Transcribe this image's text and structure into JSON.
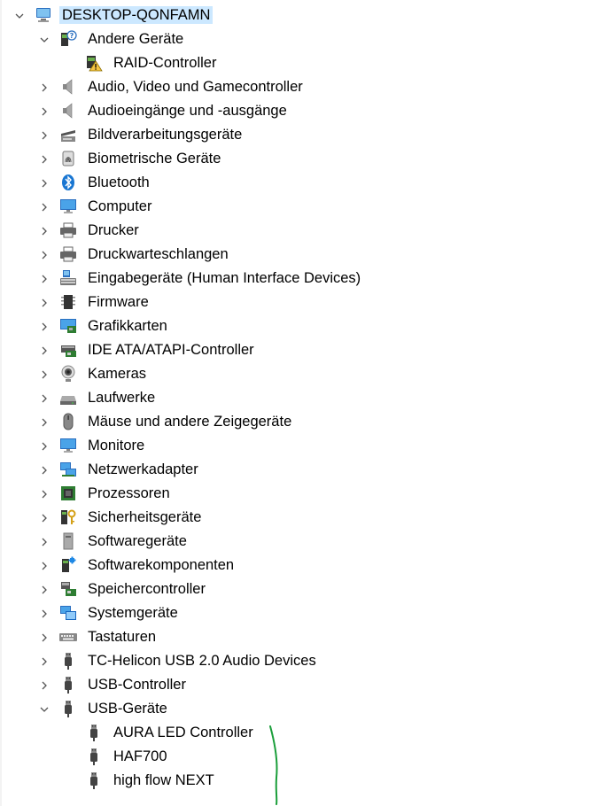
{
  "tree": {
    "root": {
      "label": "DESKTOP-QONFAMN",
      "icon": "computer-icon",
      "expanded": true
    },
    "groups": [
      {
        "label": "Andere Geräte",
        "icon": "unknown-device-icon",
        "expanded": true,
        "children": [
          {
            "label": "RAID-Controller",
            "icon": "warning-device-icon"
          }
        ]
      },
      {
        "label": "Audio, Video und Gamecontroller",
        "icon": "speaker-icon"
      },
      {
        "label": "Audioeingänge und -ausgänge",
        "icon": "speaker-icon"
      },
      {
        "label": "Bildverarbeitungsgeräte",
        "icon": "camera-scanner-icon"
      },
      {
        "label": "Biometrische Geräte",
        "icon": "fingerprint-icon"
      },
      {
        "label": "Bluetooth",
        "icon": "bluetooth-icon"
      },
      {
        "label": "Computer",
        "icon": "monitor-icon"
      },
      {
        "label": "Drucker",
        "icon": "printer-icon"
      },
      {
        "label": "Druckwarteschlangen",
        "icon": "printer-icon"
      },
      {
        "label": "Eingabegeräte (Human Interface Devices)",
        "icon": "hid-icon"
      },
      {
        "label": "Firmware",
        "icon": "chip-icon"
      },
      {
        "label": "Grafikkarten",
        "icon": "display-adapter-icon"
      },
      {
        "label": "IDE ATA/ATAPI-Controller",
        "icon": "ide-controller-icon"
      },
      {
        "label": "Kameras",
        "icon": "webcam-icon"
      },
      {
        "label": "Laufwerke",
        "icon": "drive-icon"
      },
      {
        "label": "Mäuse und andere Zeigegeräte",
        "icon": "mouse-icon"
      },
      {
        "label": "Monitore",
        "icon": "monitor-icon"
      },
      {
        "label": "Netzwerkadapter",
        "icon": "network-icon"
      },
      {
        "label": "Prozessoren",
        "icon": "processor-icon"
      },
      {
        "label": "Sicherheitsgeräte",
        "icon": "security-key-icon"
      },
      {
        "label": "Softwaregeräte",
        "icon": "software-device-icon"
      },
      {
        "label": "Softwarekomponenten",
        "icon": "software-component-icon"
      },
      {
        "label": "Speichercontroller",
        "icon": "storage-controller-icon"
      },
      {
        "label": "Systemgeräte",
        "icon": "system-device-icon"
      },
      {
        "label": "Tastaturen",
        "icon": "keyboard-icon"
      },
      {
        "label": "TC-Helicon USB 2.0 Audio Devices",
        "icon": "usb-plug-icon"
      },
      {
        "label": "USB-Controller",
        "icon": "usb-plug-icon"
      },
      {
        "label": "USB-Geräte",
        "icon": "usb-plug-icon",
        "expanded": true,
        "children": [
          {
            "label": "AURA LED Controller",
            "icon": "usb-plug-icon"
          },
          {
            "label": "HAF700",
            "icon": "usb-plug-icon"
          },
          {
            "label": "high flow NEXT",
            "icon": "usb-plug-icon"
          }
        ]
      }
    ]
  },
  "colors": {
    "selection": "#cce8ff",
    "chevron": "#555555",
    "annotation_stroke": "#1a9e3a"
  }
}
